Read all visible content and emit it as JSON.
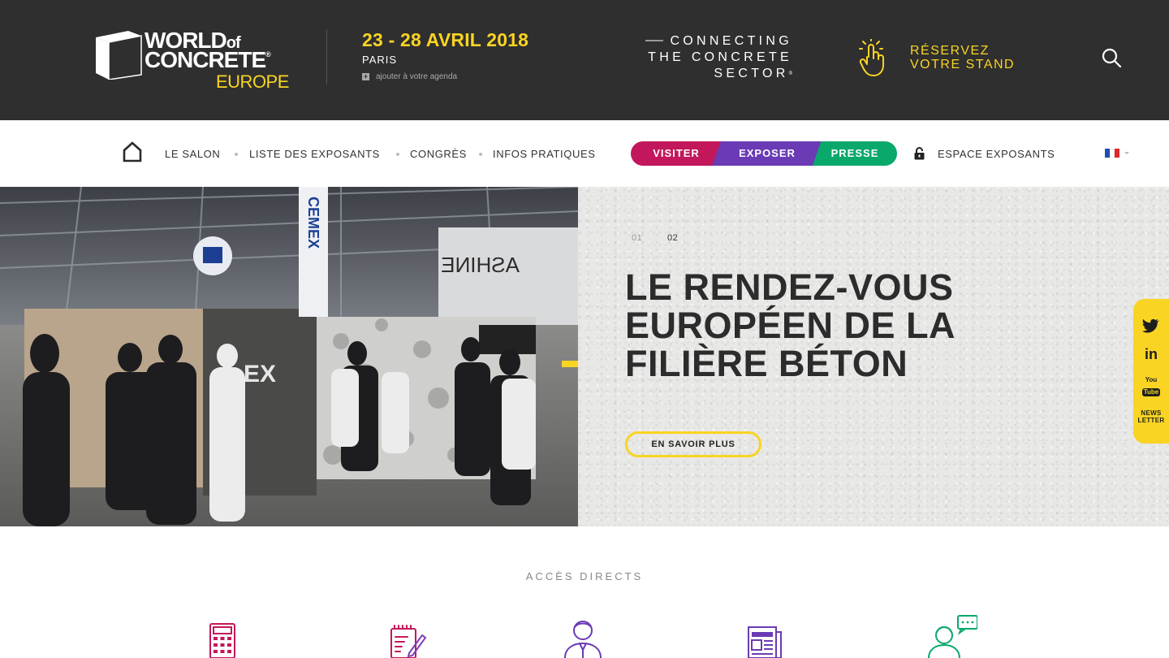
{
  "header": {
    "logo": {
      "line1": "WORLD",
      "line1_of": "of",
      "line2": "CONCRETE",
      "line3": "EUROPE",
      "registered": "®"
    },
    "event": {
      "dates": "23 - 28 AVRIL 2018",
      "city": "PARIS",
      "agenda_label": "ajouter à votre agenda"
    },
    "tagline": {
      "line1": "CONNECTING",
      "line2": "THE CONCRETE",
      "line3": "SECTOR",
      "registered": "®"
    },
    "reserve": {
      "line1": "RÉSERVEZ",
      "line2": "VOTRE STAND"
    },
    "icons": {
      "hand": "tap-hand-icon",
      "search": "search-icon"
    }
  },
  "nav": {
    "home_icon": "home-icon",
    "links": [
      "LE SALON",
      "LISTE DES EXPOSANTS",
      "CONGRÈS",
      "INFOS PRATIQUES"
    ],
    "pill": {
      "visit": "VISITER",
      "expose": "EXPOSER",
      "press": "PRESSE"
    },
    "espace": "ESPACE EXPOSANTS",
    "lock_icon": "lock-icon",
    "language_icon": "flag-fr-icon"
  },
  "hero": {
    "slides": [
      "01",
      "02"
    ],
    "active_slide": "02",
    "title_lines": [
      "LE RENDEZ-VOUS",
      "EUROPÉEN DE LA",
      "FILIÈRE BÉTON"
    ],
    "cta": "EN SAVOIR PLUS",
    "photo_text": {
      "banner_brand": "CEMEX",
      "wall_text": "ASHINE",
      "block_text": "EX"
    }
  },
  "social": {
    "twitter_icon": "twitter-icon",
    "linkedin_icon": "linkedin-icon",
    "linkedin_label": "in",
    "youtube_icon": "youtube-icon",
    "youtube_label_1": "You",
    "youtube_label_2": "Tube",
    "newsletter_line1": "NEWS",
    "newsletter_line2": "LETTER"
  },
  "acces": {
    "title": "ACCÈS DIRECTS",
    "icons": [
      "calculator-icon",
      "notepad-pen-icon",
      "businessman-icon",
      "newspaper-icon",
      "chat-person-icon"
    ]
  },
  "colors": {
    "dark_bg": "#2f2f2f",
    "accent_yellow": "#f9d423",
    "visit_magenta": "#c2185b",
    "expose_purple": "#6a3bb5",
    "press_green": "#0aa86b"
  }
}
